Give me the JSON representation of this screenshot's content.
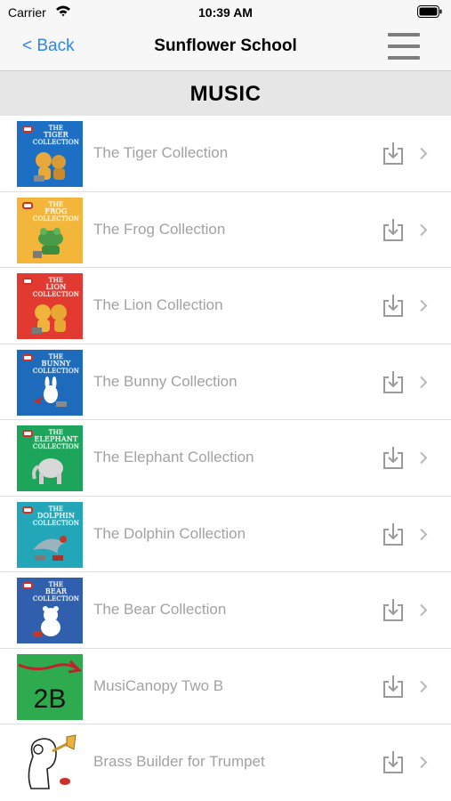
{
  "status_bar": {
    "carrier": "Carrier",
    "time": "10:39 AM",
    "wifi_icon": "wifi-icon",
    "battery_icon": "battery-icon"
  },
  "nav": {
    "back_label": "< Back",
    "title": "Sunflower School",
    "menu_icon": "hamburger-menu-icon"
  },
  "section": {
    "title": "MUSIC"
  },
  "colors": {
    "accent": "#2e86e8",
    "row_label": "#a2a2a2",
    "icon_gray": "#9a9a9a",
    "nav_background": "#f7f7f7",
    "section_background": "#e6e6e6"
  },
  "items": [
    {
      "label": "The Tiger Collection",
      "cover": {
        "color": "#1d6fc4",
        "title_top": "THE",
        "title_main": "TIGER",
        "title_sub": "COLLECTION"
      }
    },
    {
      "label": "The Frog Collection",
      "cover": {
        "color": "#f3b63a",
        "title_top": "THE",
        "title_main": "FROG",
        "title_sub": "COLLECTION"
      }
    },
    {
      "label": "The Lion Collection",
      "cover": {
        "color": "#e23a30",
        "title_top": "THE",
        "title_main": "LION",
        "title_sub": "COLLECTION"
      }
    },
    {
      "label": "The Bunny Collection",
      "cover": {
        "color": "#1f6bbb",
        "title_top": "THE",
        "title_main": "BUNNY",
        "title_sub": "COLLECTION"
      }
    },
    {
      "label": "The Elephant Collection",
      "cover": {
        "color": "#1ea55c",
        "title_top": "THE",
        "title_main": "ELEPHANT",
        "title_sub": "COLLECTION"
      }
    },
    {
      "label": "The Dolphin Collection",
      "cover": {
        "color": "#23a7b8",
        "title_top": "THE",
        "title_main": "DOLPHIN",
        "title_sub": "COLLECTION"
      }
    },
    {
      "label": "The Bear Collection",
      "cover": {
        "color": "#2f5fad",
        "title_top": "THE",
        "title_main": "BEAR",
        "title_sub": "COLLECTION"
      }
    },
    {
      "label": "MusiCanopy Two B",
      "cover": {
        "color": "#2eaa4f",
        "plain_label": "2B"
      }
    },
    {
      "label": "Brass Builder for Trumpet",
      "cover": {
        "color": "#ffffff",
        "illustration": "trumpet-player-icon"
      }
    }
  ]
}
